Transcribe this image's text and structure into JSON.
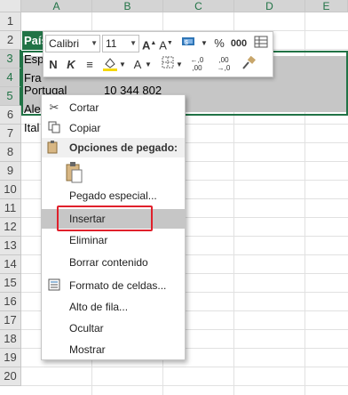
{
  "columns": [
    "A",
    "B",
    "C",
    "D",
    "E"
  ],
  "rows": [
    "1",
    "2",
    "3",
    "4",
    "5",
    "6",
    "7",
    "8",
    "9",
    "10",
    "11",
    "12",
    "13",
    "14",
    "15",
    "16",
    "17",
    "18",
    "19",
    "20"
  ],
  "cells": {
    "a1": "País",
    "a2": "Esp",
    "a3": "Fra",
    "a4": "Portugal",
    "b4": "10 344 802",
    "a5": "Ale",
    "a6": "Ital"
  },
  "mini_toolbar": {
    "font_name": "Calibri",
    "font_size": "11",
    "bold": "N",
    "italic": "K",
    "percent": "%",
    "thousands": "000",
    "increase_decimals": "←,0 ,00",
    "decrease_decimals": ",00 →,0"
  },
  "context_menu": {
    "items": [
      {
        "label": "Cortar",
        "icon": "scissors-icon"
      },
      {
        "label": "Copiar",
        "icon": "copy-icon"
      },
      {
        "label": "Opciones de pegado:",
        "icon": "paste-options-icon"
      },
      {
        "label": "Pegado especial...",
        "icon": ""
      },
      {
        "label": "Insertar",
        "icon": ""
      },
      {
        "label": "Eliminar",
        "icon": ""
      },
      {
        "label": "Borrar contenido",
        "icon": ""
      },
      {
        "label": "Formato de celdas...",
        "icon": "format-cells-icon"
      },
      {
        "label": "Alto de fila...",
        "icon": ""
      },
      {
        "label": "Ocultar",
        "icon": ""
      },
      {
        "label": "Mostrar",
        "icon": ""
      }
    ]
  },
  "colors": {
    "accent": "#217346",
    "highlight": "#e0202b",
    "hover": "#c6c6c6"
  }
}
